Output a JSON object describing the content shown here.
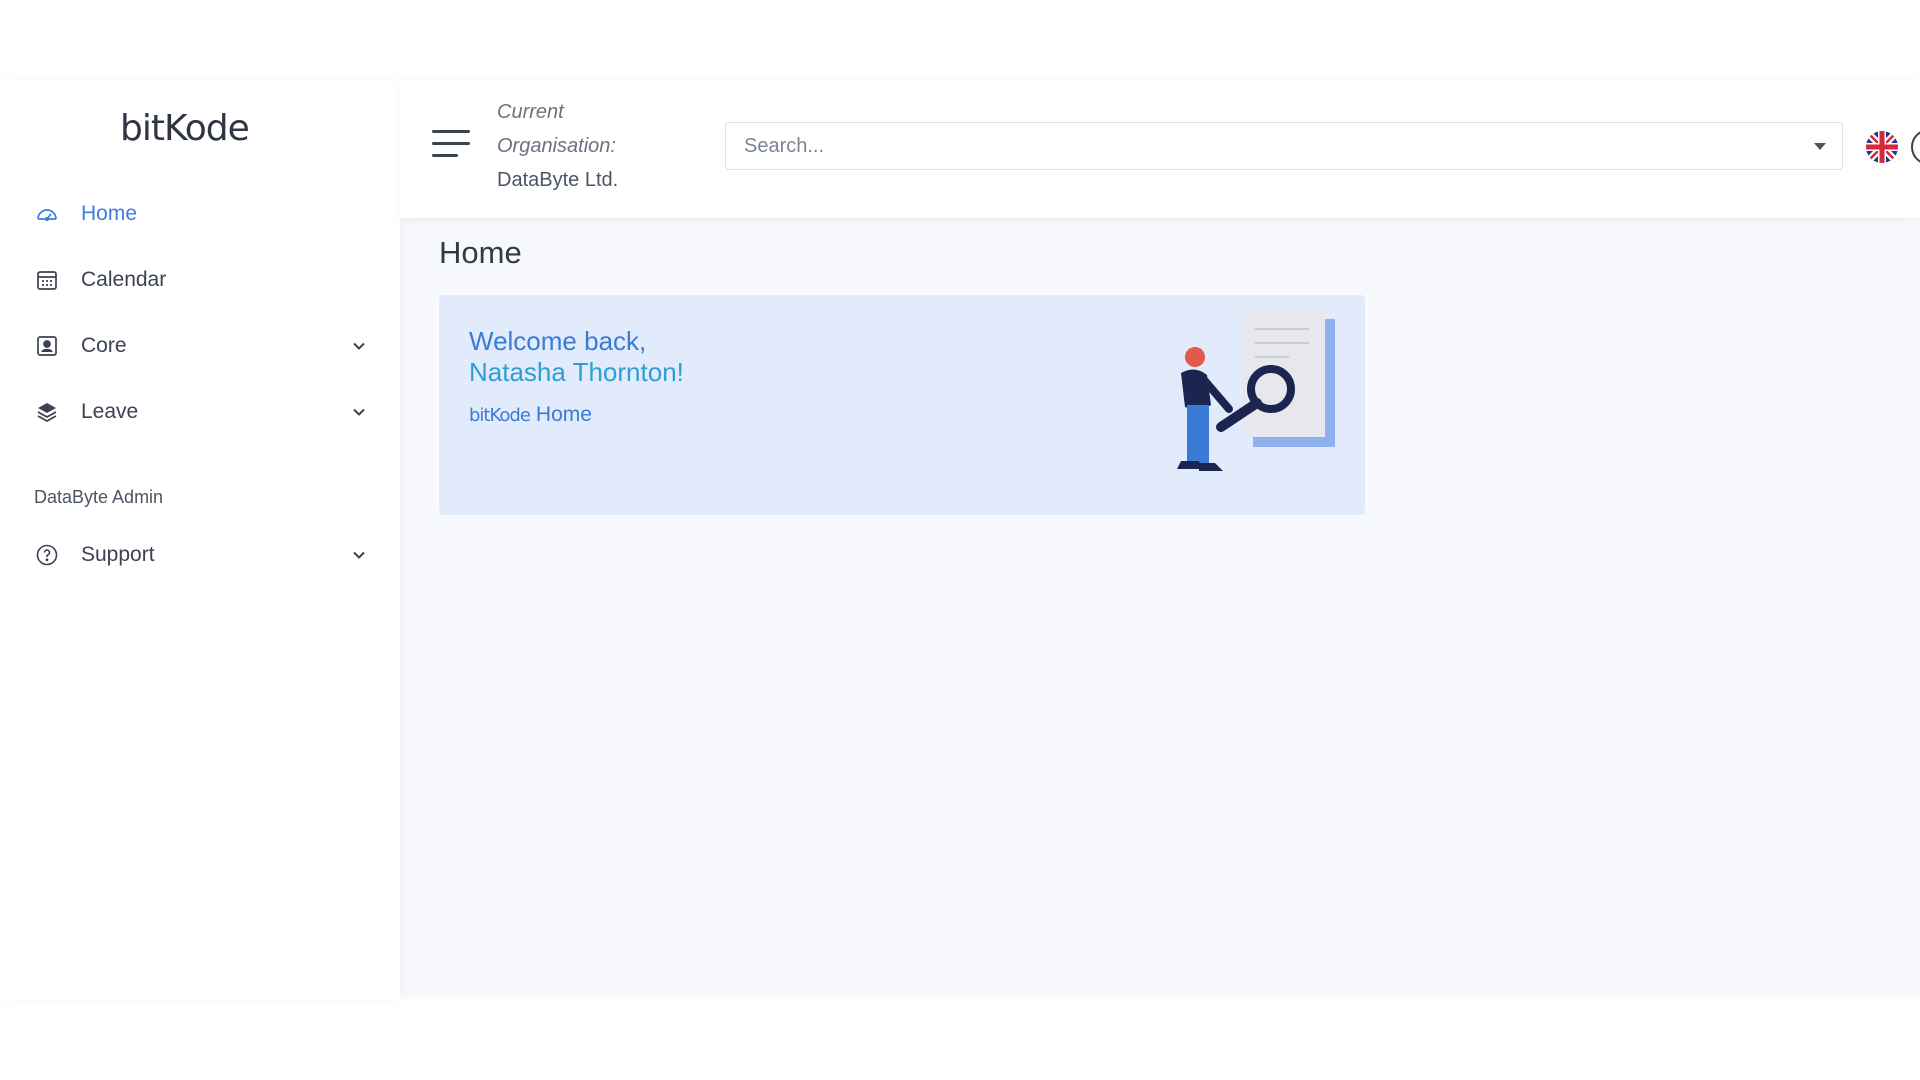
{
  "sidebar": {
    "logo": "bitKode",
    "items": [
      {
        "label": "Home",
        "icon": "dashboard-icon",
        "active": true,
        "expandable": false
      },
      {
        "label": "Calendar",
        "icon": "calendar-icon",
        "active": false,
        "expandable": false
      },
      {
        "label": "Core",
        "icon": "user-card-icon",
        "active": false,
        "expandable": true
      },
      {
        "label": "Leave",
        "icon": "layers-icon",
        "active": false,
        "expandable": true
      }
    ],
    "section_title": "DataByte Admin",
    "section_items": [
      {
        "label": "Support",
        "icon": "help-circle-icon",
        "active": false,
        "expandable": true
      }
    ]
  },
  "header": {
    "org_caption_line1": "Current",
    "org_caption_line2": "Organisation:",
    "org_name": "DataByte Ltd.",
    "search_placeholder": "Search...",
    "language_icon": "uk-flag-icon"
  },
  "main": {
    "page_title": "Home",
    "welcome_line": "Welcome back,",
    "user_name": "Natasha Thornton!",
    "link_logo": "bitKode",
    "link_text": "Home"
  },
  "colors": {
    "accent": "#3f7be0",
    "card_bg": "#e1ebfb",
    "page_bg": "#f7f9fc"
  }
}
